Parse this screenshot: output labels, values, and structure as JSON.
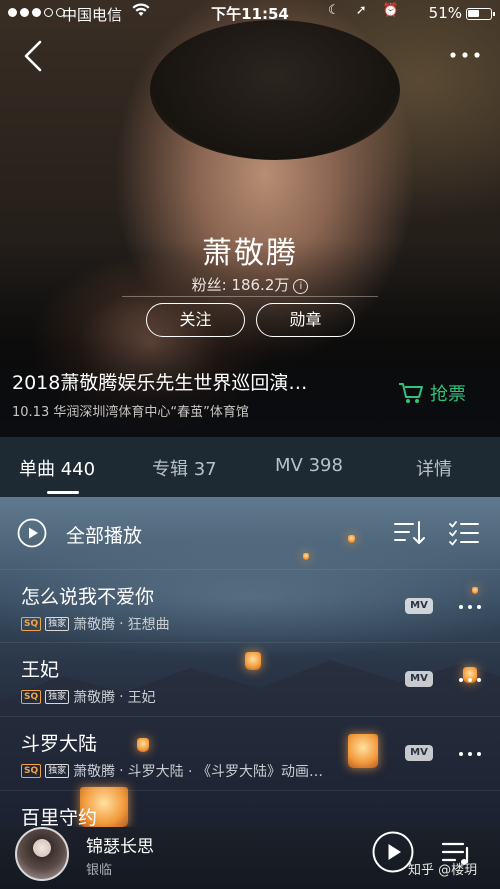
{
  "status_bar": {
    "carrier": "中国电信",
    "time": "下午11:54",
    "battery": "51%"
  },
  "artist": {
    "name": "萧敬腾",
    "fans": "粉丝: 186.2万",
    "follow_label": "关注",
    "badge_label": "勋章"
  },
  "concert": {
    "title": "2018萧敬腾娱乐先生世界巡回演…",
    "subtitle": "10.13 华润深圳湾体育中心“春茧”体育馆",
    "ticket_label": "抢票"
  },
  "tabs": [
    {
      "label": "单曲 440"
    },
    {
      "label": "专辑 37"
    },
    {
      "label": "MV 398"
    },
    {
      "label": "详情"
    }
  ],
  "play_all_label": "全部播放",
  "tags": {
    "sq": "SQ",
    "exclusive": "独家",
    "mv": "MV"
  },
  "songs": [
    {
      "title": "怎么说我不爱你",
      "artist": "萧敬腾",
      "album": "狂想曲"
    },
    {
      "title": "王妃",
      "artist": "萧敬腾",
      "album": "王妃"
    },
    {
      "title": "斗罗大陆",
      "artist": "萧敬腾",
      "album": "斗罗大陆 · 《斗罗大陆》动画…"
    },
    {
      "title": "百里守约"
    }
  ],
  "separator": "·",
  "now_playing": {
    "title": "锦瑟长思",
    "artist": "银临"
  },
  "watermark": "知乎 @楼玥",
  "colors": {
    "accent_green": "#31c27c",
    "sq_orange": "#f0a34a"
  }
}
